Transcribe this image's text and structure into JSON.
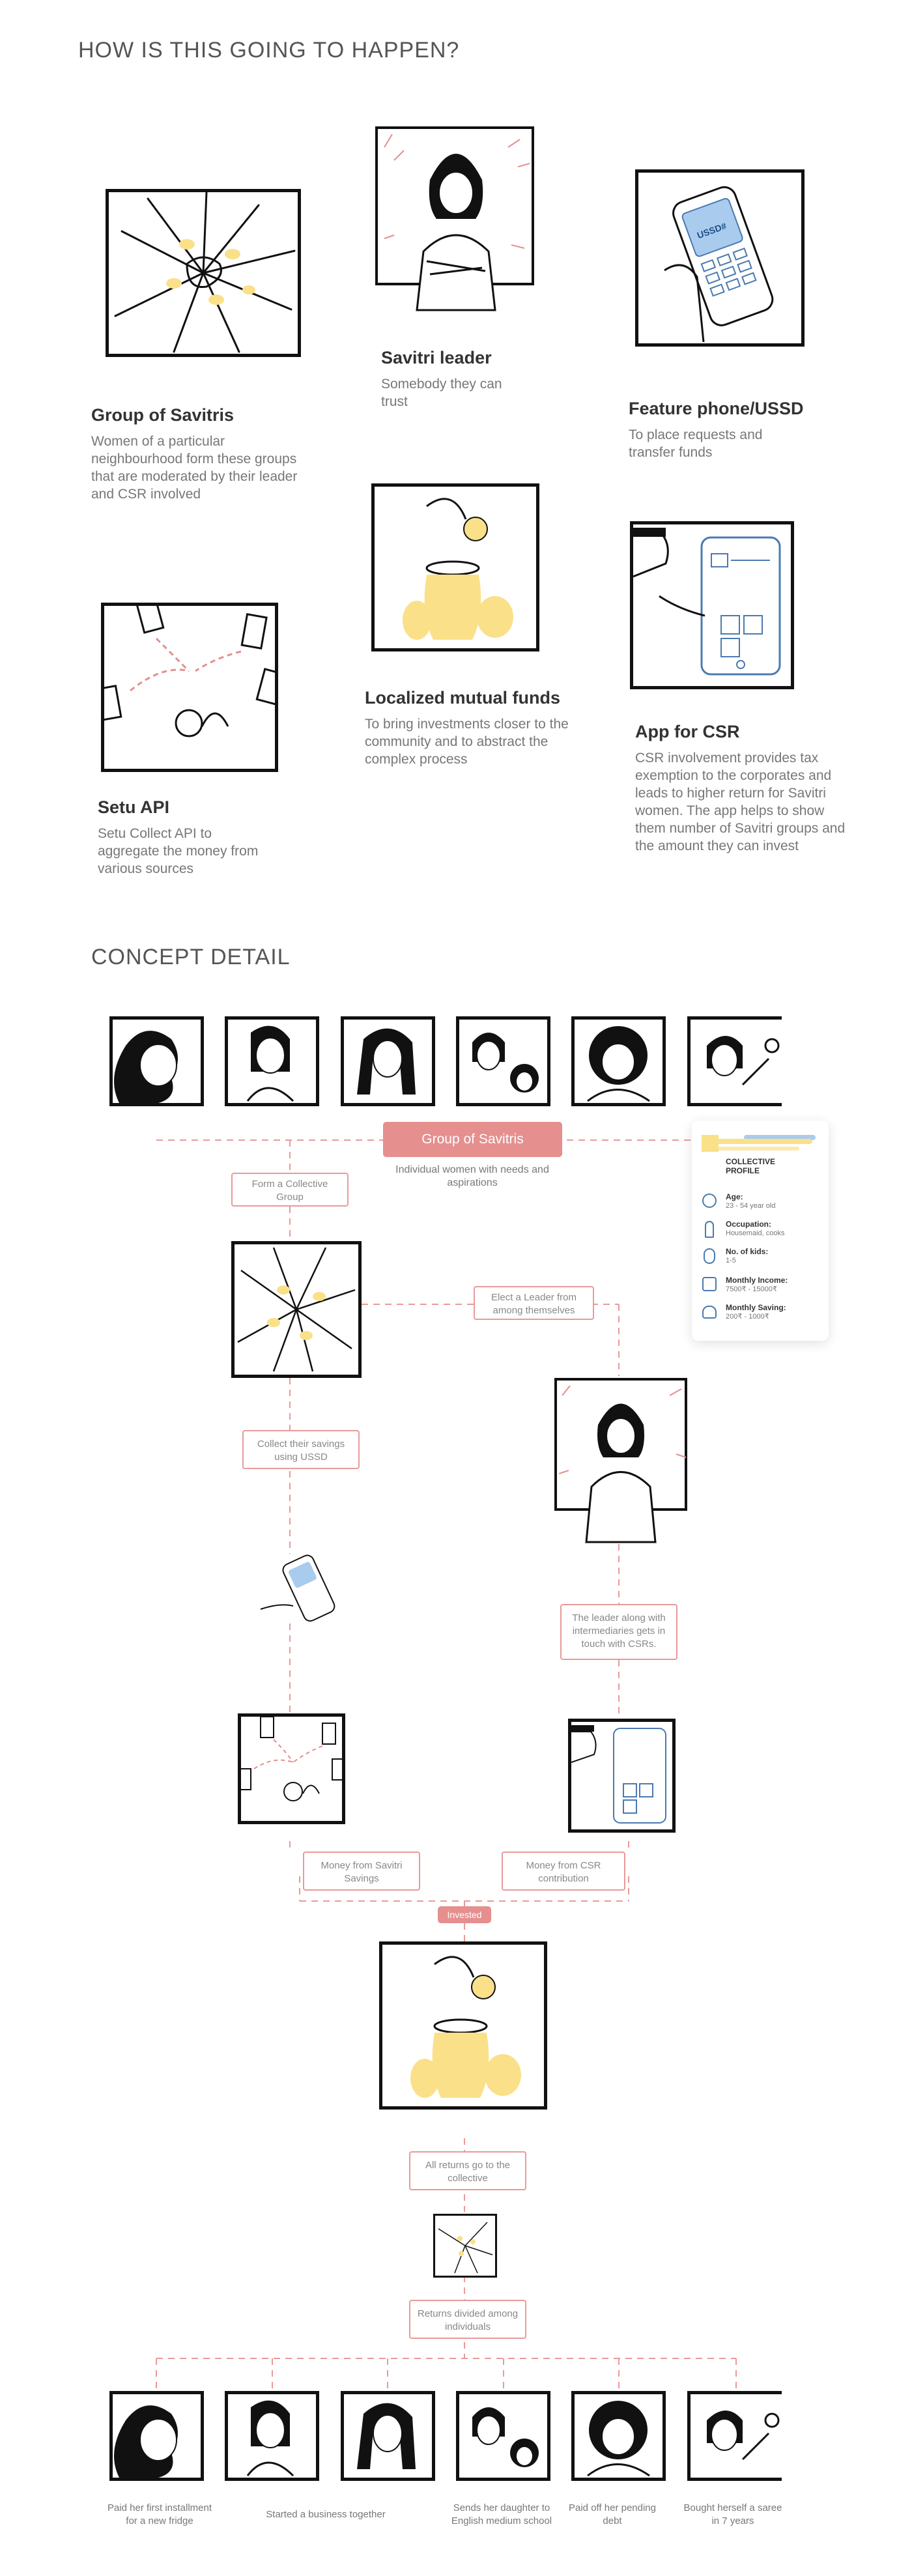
{
  "section1": {
    "heading": "HOW IS THIS GOING TO HAPPEN?",
    "cards": [
      {
        "id": "group",
        "title": "Group of Savitris",
        "desc": "Women of a particular neighbourhood form these groups that are moderated by their leader and CSR involved"
      },
      {
        "id": "leader",
        "title": "Savitri leader",
        "desc": "Somebody they can trust"
      },
      {
        "id": "phone",
        "title": "Feature phone/USSD",
        "desc": "To place requests and transfer funds"
      },
      {
        "id": "setu",
        "title": "Setu API",
        "desc": "Setu Collect API to aggregate the money from various sources"
      },
      {
        "id": "funds",
        "title": "Localized mutual funds",
        "desc": "To bring investments closer to the community and to abstract the complex process"
      },
      {
        "id": "csr",
        "title": "App for CSR",
        "desc": "CSR involvement provides tax exemption to the corporates and leads to higher return for Savitri women. The app helps to show them number of Savitri groups and the amount they can invest"
      }
    ],
    "phone_screen_text": "USSD#"
  },
  "section2": {
    "heading": "CONCEPT DETAIL",
    "group_pill": "Group of Savitris",
    "group_caption": "Individual women with needs and aspirations",
    "steps": {
      "form": "Form a Collective Group",
      "elect": "Elect a Leader from among themselves",
      "collect": "Collect their savings using USSD",
      "leader_csr": "The leader along with intermediaries gets in touch with CSRs.",
      "money_savitri": "Money from Savitri Savings",
      "money_csr": "Money from CSR contribution",
      "invested": "Invested",
      "returns_collective": "All returns go to the collective",
      "returns_divided": "Returns divided among individuals"
    },
    "profile": {
      "title_line1": "COLLECTIVE",
      "title_line2": "PROFILE",
      "rows": [
        {
          "label": "Age:",
          "value": "23 - 54 year old"
        },
        {
          "label": "Occupation:",
          "value": "Housemaid, cooks"
        },
        {
          "label": "No. of kids:",
          "value": "1-5"
        },
        {
          "label": "Monthly Income:",
          "value": "7500₹ - 15000₹"
        },
        {
          "label": "Monthly Saving:",
          "value": "200₹ - 1000₹"
        }
      ]
    },
    "outcomes": [
      "Paid her first installment for a new fridge",
      "Started a business together",
      "Sends her daughter to English medium school",
      "Paid off her pending debt",
      "Bought herself a saree in 7 years"
    ]
  },
  "colors": {
    "accent": "#e58f8f",
    "accent_line": "#e99a9a",
    "yellow": "#fbe08a",
    "blue": "#a9cbee",
    "ink": "#111111"
  }
}
